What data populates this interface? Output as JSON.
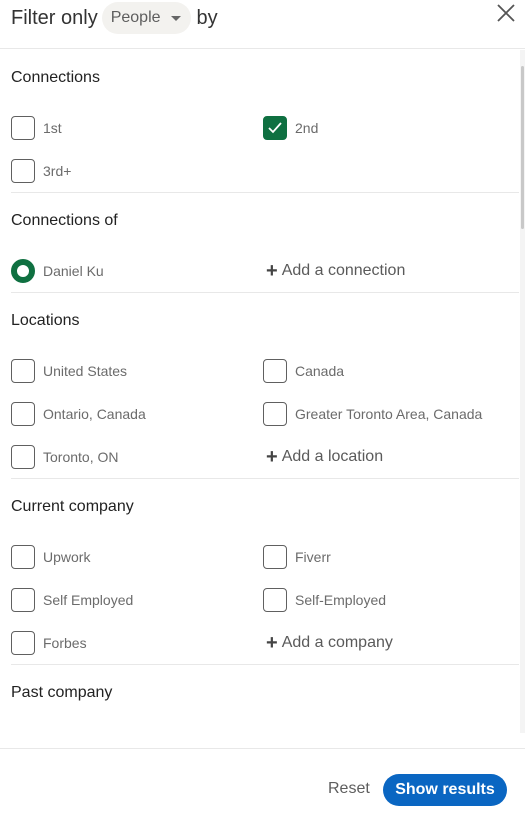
{
  "header": {
    "prefix": "Filter only",
    "type_selected": "People",
    "suffix": "by",
    "close_icon": "close-icon"
  },
  "sections": {
    "connections": {
      "title": "Connections",
      "options": [
        {
          "label": "1st",
          "checked": false
        },
        {
          "label": "2nd",
          "checked": true
        },
        {
          "label": "3rd+",
          "checked": false
        }
      ]
    },
    "connections_of": {
      "title": "Connections of",
      "selected": {
        "label": "Daniel Ku",
        "selected": true
      },
      "add_label": "Add a connection"
    },
    "locations": {
      "title": "Locations",
      "options": [
        {
          "label": "United States",
          "checked": false
        },
        {
          "label": "Canada",
          "checked": false
        },
        {
          "label": "Ontario, Canada",
          "checked": false
        },
        {
          "label": "Greater Toronto Area, Canada",
          "checked": false
        },
        {
          "label": "Toronto, ON",
          "checked": false
        }
      ],
      "add_label": "Add a location"
    },
    "current_company": {
      "title": "Current company",
      "options": [
        {
          "label": "Upwork",
          "checked": false
        },
        {
          "label": "Fiverr",
          "checked": false
        },
        {
          "label": "Self Employed",
          "checked": false
        },
        {
          "label": "Self-Employed",
          "checked": false
        },
        {
          "label": "Forbes",
          "checked": false
        }
      ],
      "add_label": "Add a company"
    },
    "past_company": {
      "title": "Past company"
    }
  },
  "footer": {
    "reset_label": "Reset",
    "show_results_label": "Show results"
  },
  "colors": {
    "checked_green": "#0f7041",
    "primary_blue": "#0a66c2"
  }
}
